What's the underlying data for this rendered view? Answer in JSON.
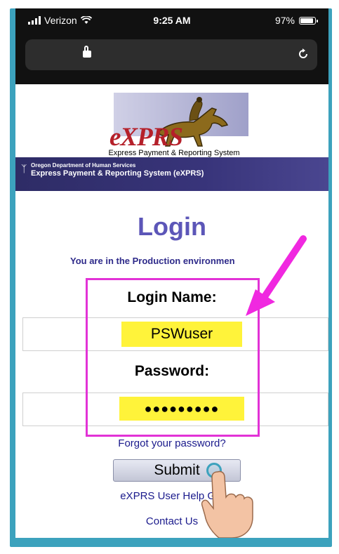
{
  "statusbar": {
    "carrier": "Verizon",
    "time": "9:25 AM",
    "battery": "97%",
    "battery_level": 0.97
  },
  "browser": {
    "lock_icon": "lock-icon",
    "reload_icon": "reload-icon"
  },
  "logo": {
    "name": "eXPRS",
    "subtitle": "Express Payment & Reporting System"
  },
  "banner": {
    "org": "Oregon Department of Human Services",
    "system": "Express Payment & Reporting System (eXPRS)"
  },
  "login": {
    "title": "Login",
    "environment_text": "You are in the Production environmen",
    "login_name_label": "Login Name:",
    "login_name_value": "PSWuser",
    "password_label": "Password:",
    "password_value": "●●●●●●●●●",
    "forgot_link": "Forgot your password?",
    "submit_label": "Submit",
    "help_link": "eXPRS User Help Gui",
    "contact_link": "Contact Us"
  },
  "colors": {
    "frame": "#3ca2bd",
    "title": "#5c56b8",
    "highlight": "#e232d6",
    "field_highlight": "#fff33a",
    "link": "#1a1a8c"
  }
}
